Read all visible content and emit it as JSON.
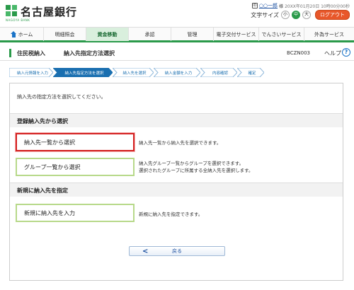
{
  "header": {
    "bank_name": "名古屋銀行",
    "bank_sub": "NAGOYA BANK",
    "user_icon": "ID",
    "user_name": "○○一郎",
    "user_suffix": "様",
    "last_login": "20XX年01月20日 10時00分00秒",
    "font_size_label": "文字サイズ",
    "font_small": "小",
    "font_medium": "中",
    "font_large": "大",
    "logout_label": "ログアウト"
  },
  "nav": {
    "items": [
      {
        "label": "ホーム",
        "icon": "home-icon"
      },
      {
        "label": "明細照会"
      },
      {
        "label": "資金移動"
      },
      {
        "label": "承認"
      },
      {
        "label": "管理"
      },
      {
        "label": "電子交付サービス"
      },
      {
        "label": "でんさいサービス"
      },
      {
        "label": "外為サービス"
      }
    ],
    "active_index": 2
  },
  "page": {
    "title": "住民税納入",
    "subtitle": "納入先指定方法選択",
    "screen_id": "BCZN003",
    "help_label": "ヘルプ",
    "help_icon": "?"
  },
  "steps": [
    {
      "label": "納入元情報を入力"
    },
    {
      "label": "納入先指定方法を選択",
      "active": true
    },
    {
      "label": "納入先を選択"
    },
    {
      "label": "納入金額を入力"
    },
    {
      "label": "内容確認"
    },
    {
      "label": "確定"
    }
  ],
  "content": {
    "instruction": "納入先の指定方法を選択してください。",
    "section1_title": "登録納入先から選択",
    "option1_label": "納入先一覧から選択",
    "option1_desc": "納入先一覧から納入先を選択できます。",
    "option2_label": "グループ一覧から選択",
    "option2_desc_line1": "納入先グループ一覧からグループを選択できます。",
    "option2_desc_line2": "選択されたグループに所属する全納入先を選択します。",
    "section2_title": "新規に納入先を指定",
    "option3_label": "新規に納入先を入力",
    "option3_desc": "新規に納入先を指定できます。",
    "back_label": "戻る",
    "back_chevron": "<"
  },
  "colors": {
    "brand_green": "#2a9a4a",
    "option_border": "#b7d98a",
    "highlight_red": "#d42121",
    "logout_orange": "#e8572a",
    "step_blue": "#1a6fb0"
  }
}
